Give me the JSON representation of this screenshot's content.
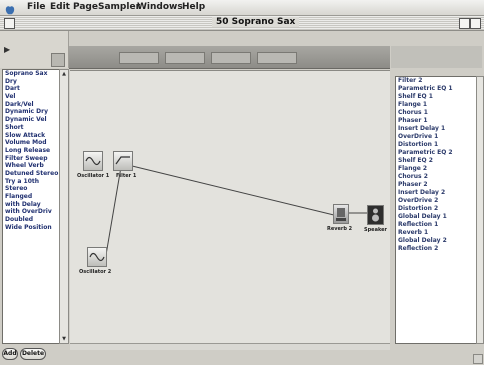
{
  "menubar": {
    "items": [
      "File",
      "Edit",
      "Page",
      "Sampler",
      "Windows",
      "Help"
    ]
  },
  "window": {
    "title": "50 Soprano Sax"
  },
  "left_panel": {
    "items": [
      "Soprano Sax",
      "Dry",
      "Dart",
      "Vel",
      "Dark/Vel",
      "Dynamic Dry",
      "Dynamic Vel",
      "Short",
      "Slow Attack",
      "Volume Mod",
      "Long Release",
      "Filter Sweep",
      "Wheel Verb",
      "Detuned Stereo",
      "Try a 10th",
      "Stereo",
      "Flanged",
      "with Delay",
      "with OverDriv",
      "Doubled",
      "Wide Position"
    ],
    "add_label": "Add",
    "delete_label": "Delete"
  },
  "canvas": {
    "nodes": [
      {
        "id": "oscillator-1",
        "label": "Oscillator 1"
      },
      {
        "id": "filter-1",
        "label": "Filter 1"
      },
      {
        "id": "oscillator-2",
        "label": "Oscillator 2"
      },
      {
        "id": "reverb-2",
        "label": "Reverb 2"
      },
      {
        "id": "speaker",
        "label": "Speaker"
      }
    ]
  },
  "right_panel": {
    "items": [
      "Filter 2",
      "Parametric EQ 1",
      "Shelf EQ 1",
      "Flange 1",
      "Chorus 1",
      "Phaser 1",
      "Insert Delay 1",
      "OverDrive 1",
      "Distortion 1",
      "Parametric EQ 2",
      "Shelf EQ 2",
      "Flange 2",
      "Chorus 2",
      "Phaser 2",
      "Insert Delay 2",
      "OverDrive 2",
      "Distortion 2",
      "Global Delay 1",
      "Reflection 1",
      "Reverb 1",
      "Global Delay 2",
      "Reflection 2"
    ]
  },
  "icons": {
    "apple": "apple-logo-icon",
    "wave": "sine-wave-icon",
    "reverb": "reverb-chip-icon",
    "speaker": "speaker-icon"
  }
}
